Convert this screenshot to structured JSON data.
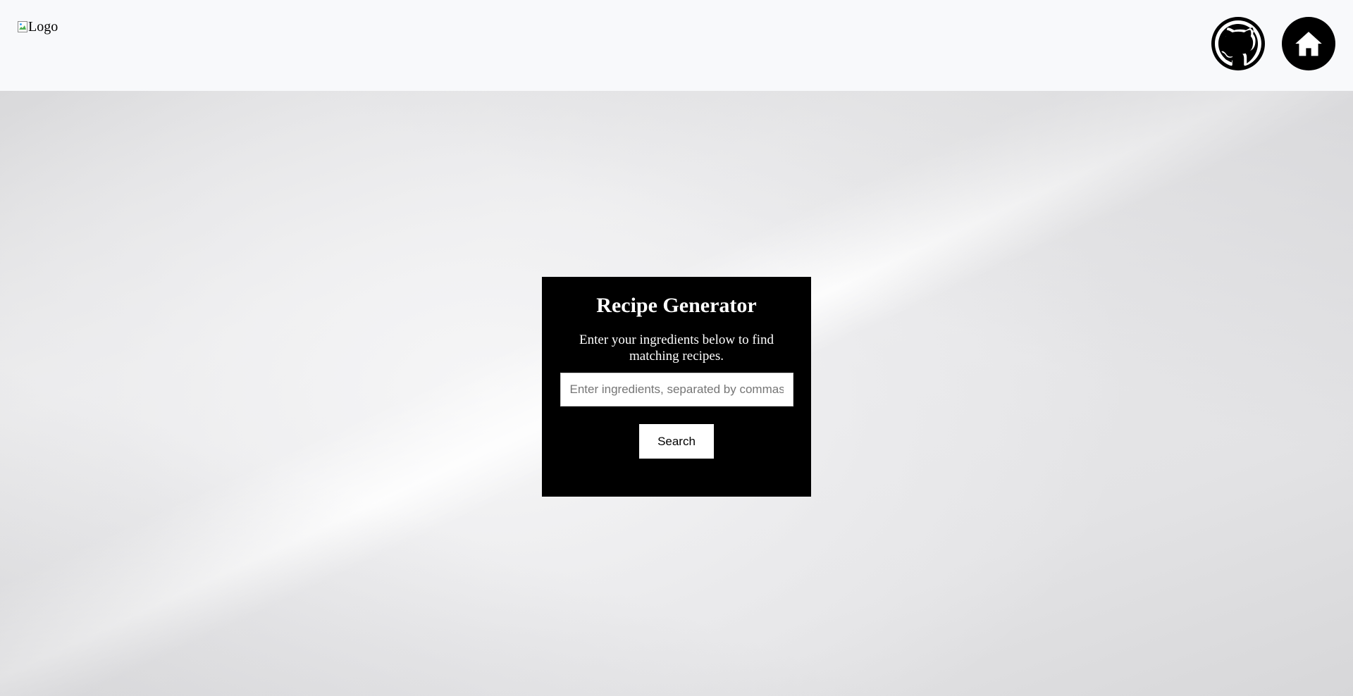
{
  "header": {
    "logo_alt": "Logo",
    "icons": {
      "github": "github-icon",
      "home": "home-icon"
    }
  },
  "card": {
    "title": "Recipe Generator",
    "description": "Enter your ingredients below to find matching recipes.",
    "search_input": {
      "value": "",
      "placeholder": "Enter ingredients, separated by commas"
    },
    "search_button_label": "Search"
  },
  "colors": {
    "navbar_bg": "#f8f9fb",
    "card_bg": "#000000",
    "card_text": "#ffffff",
    "icon_bg": "#000000"
  }
}
